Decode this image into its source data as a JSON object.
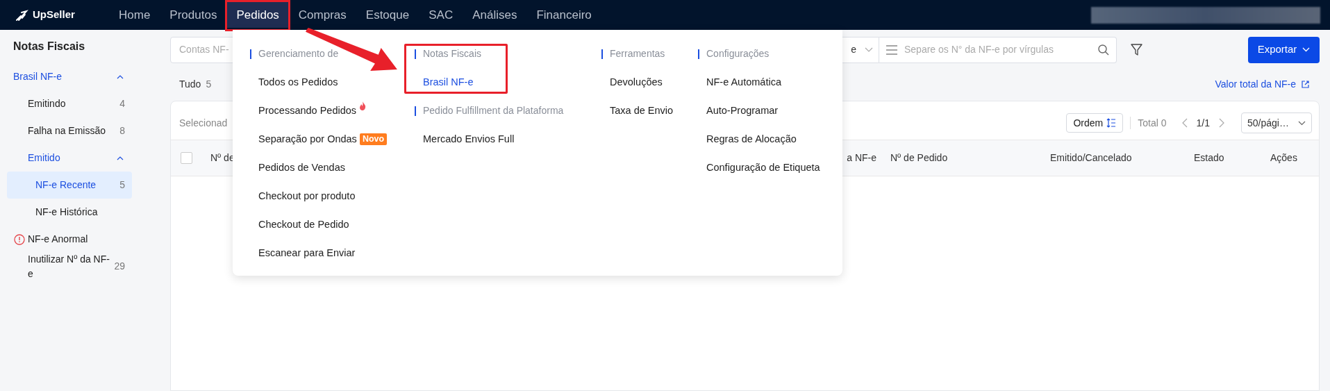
{
  "nav": {
    "logo": "UpSeller",
    "items": [
      {
        "label": "Home",
        "selected": false,
        "highlighted": false
      },
      {
        "label": "Produtos",
        "selected": false,
        "highlighted": false
      },
      {
        "label": "Pedidos",
        "selected": true,
        "highlighted": true
      },
      {
        "label": "Compras",
        "selected": false,
        "highlighted": false
      },
      {
        "label": "Estoque",
        "selected": false,
        "highlighted": false
      },
      {
        "label": "SAC",
        "selected": false,
        "highlighted": false
      },
      {
        "label": "Análises",
        "selected": false,
        "highlighted": false
      },
      {
        "label": "Financeiro",
        "selected": false,
        "highlighted": false
      }
    ]
  },
  "sidebar": {
    "title": "Notas Fiscais",
    "items": [
      {
        "label": "Brasil NF-e",
        "expanded": true,
        "selected": false,
        "alert": false,
        "children": [
          {
            "label": "Emitindo",
            "count": "4",
            "selected": false,
            "alert": false
          },
          {
            "label": "Falha na Emissão",
            "count": "8",
            "selected": false,
            "alert": false
          },
          {
            "label": "Emitido",
            "expanded": true,
            "selected": false,
            "alert": false,
            "children": [
              {
                "label": "NF-e Recente",
                "count": "5",
                "selected": true,
                "alert": false
              },
              {
                "label": "NF-e Histórica",
                "selected": false,
                "alert": false
              }
            ]
          }
        ]
      },
      {
        "label": "NF-e Anormal",
        "selected": false,
        "alert": true
      },
      {
        "label": "Inutilizar Nº da NF-e",
        "count": "29",
        "selected": false,
        "alert": false
      }
    ]
  },
  "toolbar": {
    "account_field": {
      "placeholder": "Contas NF-"
    },
    "select": {
      "value": "e"
    },
    "search": {
      "placeholder": "Separe os N° da NF-e por vírgulas"
    },
    "export_button": "Exportar"
  },
  "status_tabs": [
    {
      "label": "Tudo",
      "count": "5"
    }
  ],
  "total_link": "Valor total da NF-e",
  "table": {
    "selection_label": "Selecionad",
    "select_all_checked": false,
    "sort_button": "Ordem",
    "total": "Total 0",
    "page": "1/1",
    "page_size": "50/pági…",
    "columns": [
      "Nº de",
      "a NF-e",
      "Nº de Pedido",
      "Emitido/Cancelado",
      "Estado",
      "Ações"
    ]
  },
  "dropdown": {
    "columns": [
      {
        "groups": [
          {
            "header": "Gerenciamento de",
            "highlighted": false,
            "items": [
              {
                "label": "Todos os Pedidos",
                "selected": false
              },
              {
                "label": "Processando Pedidos",
                "selected": false,
                "hot": true
              },
              {
                "label": "Separação por Ondas",
                "selected": false,
                "badge": "Novo"
              },
              {
                "label": "Pedidos de Vendas",
                "selected": false
              },
              {
                "label": "Checkout por produto",
                "selected": false
              },
              {
                "label": "Checkout de Pedido",
                "selected": false
              },
              {
                "label": "Escanear para Enviar",
                "selected": false
              }
            ]
          }
        ]
      },
      {
        "groups": [
          {
            "header": "Notas Fiscais",
            "highlighted": true,
            "items": [
              {
                "label": "Brasil NF-e",
                "selected": true
              }
            ]
          },
          {
            "header": "Pedido Fulfillment da Plataforma",
            "highlighted": false,
            "items": [
              {
                "label": "Mercado Envios Full",
                "selected": false
              }
            ]
          }
        ]
      },
      {
        "groups": [
          {
            "header": "Ferramentas",
            "highlighted": false,
            "items": [
              {
                "label": "Devoluções",
                "selected": false
              },
              {
                "label": "Taxa de Envio",
                "selected": false
              }
            ]
          }
        ]
      },
      {
        "groups": [
          {
            "header": "Configurações",
            "highlighted": false,
            "items": [
              {
                "label": "NF-e Automática",
                "selected": false
              },
              {
                "label": "Auto-Programar",
                "selected": false
              },
              {
                "label": "Regras de Alocação",
                "selected": false
              },
              {
                "label": "Configuração de Etiqueta",
                "selected": false
              }
            ]
          }
        ]
      }
    ]
  }
}
